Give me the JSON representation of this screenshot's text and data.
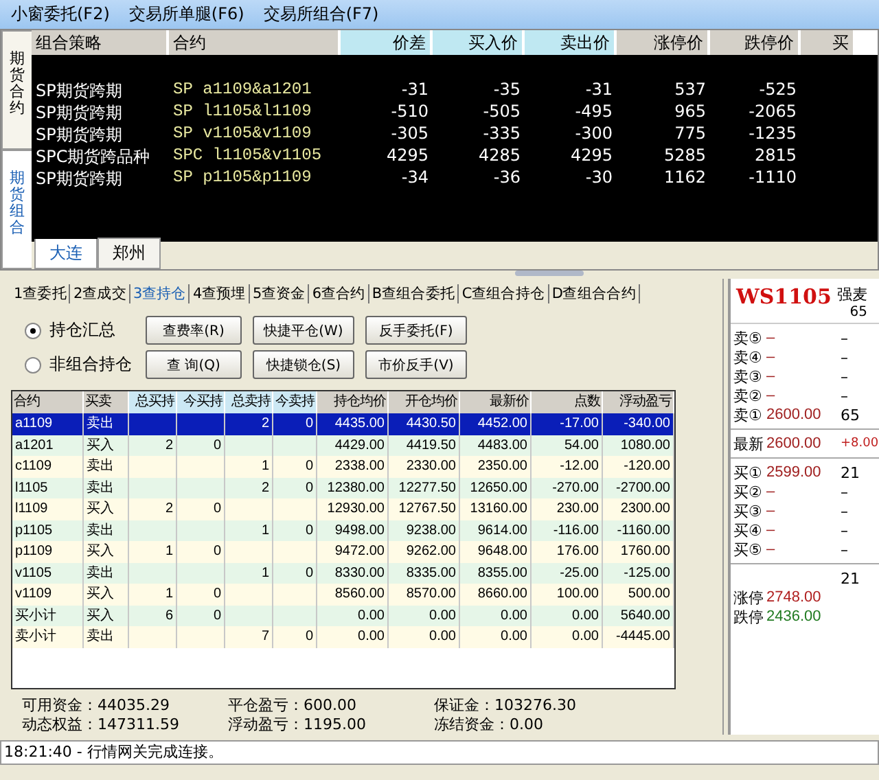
{
  "menu": [
    {
      "label": "小窗委托(F2)"
    },
    {
      "label": "交易所单腿(F6)"
    },
    {
      "label": "交易所组合(F7)"
    }
  ],
  "top": {
    "side_tabs": [
      {
        "label": "期货合约",
        "selected": false
      },
      {
        "label": "期货组合",
        "selected": true
      }
    ],
    "columns": [
      {
        "label": "组合策略",
        "kind": "info"
      },
      {
        "label": "合约",
        "kind": "info"
      },
      {
        "label": "价差",
        "kind": "quote"
      },
      {
        "label": "买入价",
        "kind": "quote"
      },
      {
        "label": "卖出价",
        "kind": "quote"
      },
      {
        "label": "涨停价",
        "kind": "info"
      },
      {
        "label": "跌停价",
        "kind": "info"
      },
      {
        "label": "买",
        "kind": "info"
      }
    ],
    "rows": [
      [
        "SP期货跨期",
        "SP a1109&a1201",
        "-31",
        "-35",
        "-31",
        "537",
        "-525"
      ],
      [
        "SP期货跨期",
        "SP l1105&l1109",
        "-510",
        "-505",
        "-495",
        "965",
        "-2065"
      ],
      [
        "SP期货跨期",
        "SP v1105&v1109",
        "-305",
        "-335",
        "-300",
        "775",
        "-1235"
      ],
      [
        "SPC期货跨品种",
        "SPC l1105&v1105",
        "4295",
        "4285",
        "4295",
        "5285",
        "2815"
      ],
      [
        "SP期货跨期",
        "SP p1105&p1109",
        "-34",
        "-36",
        "-30",
        "1162",
        "-1110"
      ]
    ],
    "exchange_tabs": [
      {
        "label": "大连",
        "selected": true
      },
      {
        "label": "郑州",
        "selected": false
      }
    ]
  },
  "lower": {
    "tabs": [
      {
        "label": "1查委托",
        "selected": false
      },
      {
        "label": "2查成交",
        "selected": false
      },
      {
        "label": "3查持仓",
        "selected": true
      },
      {
        "label": "4查预埋",
        "selected": false
      },
      {
        "label": "5查资金",
        "selected": false
      },
      {
        "label": "6查合约",
        "selected": false
      },
      {
        "label": "B查组合委托",
        "selected": false
      },
      {
        "label": "C查组合持仓",
        "selected": false
      },
      {
        "label": "D查组合合约",
        "selected": false
      }
    ],
    "radios": [
      {
        "label": "持仓汇总",
        "selected": true
      },
      {
        "label": "非组合持仓",
        "selected": false
      }
    ],
    "buttons": [
      [
        "查费率(R)",
        "快捷平仓(W)",
        "反手委托(F)"
      ],
      [
        "查 询(Q)",
        "快捷锁仓(S)",
        "市价反手(V)"
      ]
    ],
    "columns": [
      {
        "label": "合约",
        "kind": "info"
      },
      {
        "label": "买卖",
        "kind": "info"
      },
      {
        "label": "总买持",
        "kind": "qty"
      },
      {
        "label": "今买持",
        "kind": "qty"
      },
      {
        "label": "总卖持",
        "kind": "qty"
      },
      {
        "label": "今卖持",
        "kind": "qty"
      },
      {
        "label": "持仓均价",
        "kind": "info"
      },
      {
        "label": "开仓均价",
        "kind": "info"
      },
      {
        "label": "最新价",
        "kind": "info"
      },
      {
        "label": "点数",
        "kind": "info"
      },
      {
        "label": "浮动盈亏",
        "kind": "info"
      }
    ],
    "rows": [
      {
        "selected": true,
        "cells": [
          "a1109",
          "卖出",
          "",
          "",
          "2",
          "0",
          "4435.00",
          "4430.50",
          "4452.00",
          "-17.00",
          "-340.00"
        ]
      },
      {
        "selected": false,
        "cells": [
          "a1201",
          "买入",
          "2",
          "0",
          "",
          "",
          "4429.00",
          "4419.50",
          "4483.00",
          "54.00",
          "1080.00"
        ]
      },
      {
        "selected": false,
        "cells": [
          "c1109",
          "卖出",
          "",
          "",
          "1",
          "0",
          "2338.00",
          "2330.00",
          "2350.00",
          "-12.00",
          "-120.00"
        ]
      },
      {
        "selected": false,
        "cells": [
          "l1105",
          "卖出",
          "",
          "",
          "2",
          "0",
          "12380.00",
          "12277.50",
          "12650.00",
          "-270.00",
          "-2700.00"
        ]
      },
      {
        "selected": false,
        "cells": [
          "l1109",
          "买入",
          "2",
          "0",
          "",
          "",
          "12930.00",
          "12767.50",
          "13160.00",
          "230.00",
          "2300.00"
        ]
      },
      {
        "selected": false,
        "cells": [
          "p1105",
          "卖出",
          "",
          "",
          "1",
          "0",
          "9498.00",
          "9238.00",
          "9614.00",
          "-116.00",
          "-1160.00"
        ]
      },
      {
        "selected": false,
        "cells": [
          "p1109",
          "买入",
          "1",
          "0",
          "",
          "",
          "9472.00",
          "9262.00",
          "9648.00",
          "176.00",
          "1760.00"
        ]
      },
      {
        "selected": false,
        "cells": [
          "v1105",
          "卖出",
          "",
          "",
          "1",
          "0",
          "8330.00",
          "8335.00",
          "8355.00",
          "-25.00",
          "-125.00"
        ]
      },
      {
        "selected": false,
        "cells": [
          "v1109",
          "买入",
          "1",
          "0",
          "",
          "",
          "8560.00",
          "8570.00",
          "8660.00",
          "100.00",
          "500.00"
        ]
      },
      {
        "selected": false,
        "cells": [
          "买小计",
          "买入",
          "6",
          "0",
          "",
          "",
          "0.00",
          "0.00",
          "0.00",
          "0.00",
          "5640.00"
        ]
      },
      {
        "selected": false,
        "cells": [
          "卖小计",
          "卖出",
          "",
          "",
          "7",
          "0",
          "0.00",
          "0.00",
          "0.00",
          "0.00",
          "-4445.00"
        ]
      }
    ],
    "summary": [
      [
        "可用资金：44035.29",
        "平仓盈亏：600.00",
        "保证金：103276.30"
      ],
      [
        "动态权益：147311.59",
        "浮动盈亏：1195.00",
        "冻结资金：0.00"
      ]
    ]
  },
  "quote": {
    "code": "WS1105",
    "name": "强麦",
    "volume": "65",
    "asks": [
      {
        "label": "卖⑤",
        "price": "–",
        "volume": "–"
      },
      {
        "label": "卖④",
        "price": "–",
        "volume": "–"
      },
      {
        "label": "卖③",
        "price": "–",
        "volume": "–"
      },
      {
        "label": "卖②",
        "price": "–",
        "volume": "–"
      },
      {
        "label": "卖①",
        "price": "2600.00",
        "volume": "65"
      }
    ],
    "last": {
      "label": "最新",
      "price": "2600.00",
      "change": "+8.00"
    },
    "bids": [
      {
        "label": "买①",
        "price": "2599.00",
        "volume": "21"
      },
      {
        "label": "买②",
        "price": "–",
        "volume": "–"
      },
      {
        "label": "买③",
        "price": "–",
        "volume": "–"
      },
      {
        "label": "买④",
        "price": "–",
        "volume": "–"
      },
      {
        "label": "买⑤",
        "price": "–",
        "volume": "–"
      }
    ],
    "total": "21",
    "limits": [
      {
        "label": "涨停",
        "value": "2748.00",
        "kind": "up"
      },
      {
        "label": "跌停",
        "value": "2436.00",
        "kind": "down"
      }
    ]
  },
  "status_bar": "18:21:40 - 行情网关完成连接。"
}
